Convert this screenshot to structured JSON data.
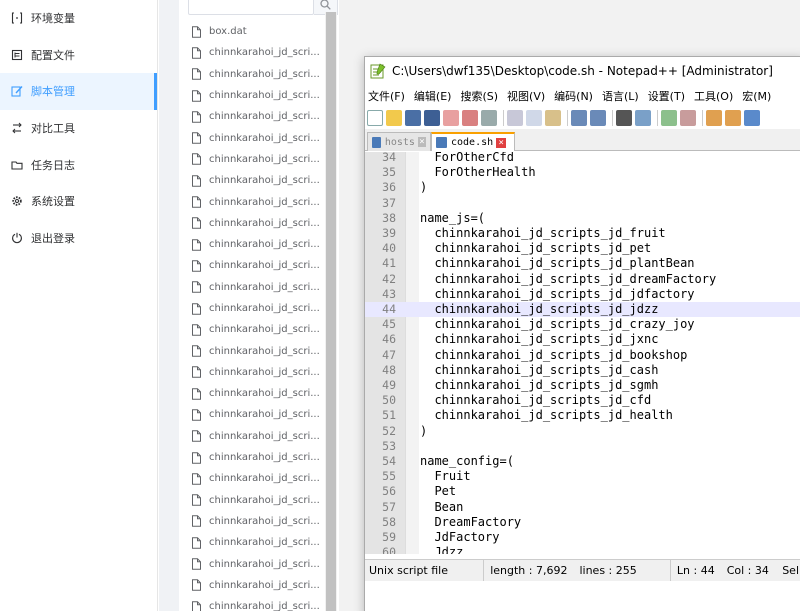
{
  "nav": {
    "items": [
      {
        "label": "环境变量",
        "icon": "variable-icon",
        "active": false
      },
      {
        "label": "配置文件",
        "icon": "config-file-icon",
        "active": false
      },
      {
        "label": "脚本管理",
        "icon": "script-edit-icon",
        "active": true
      },
      {
        "label": "对比工具",
        "icon": "compare-icon",
        "active": false
      },
      {
        "label": "任务日志",
        "icon": "folder-log-icon",
        "active": false
      },
      {
        "label": "系统设置",
        "icon": "settings-gear-icon",
        "active": false
      },
      {
        "label": "退出登录",
        "icon": "logout-icon",
        "active": false
      }
    ]
  },
  "files": {
    "search_placeholder": "",
    "items": [
      "box.dat",
      "chinnkarahoi_jd_scri...",
      "chinnkarahoi_jd_scri...",
      "chinnkarahoi_jd_scri...",
      "chinnkarahoi_jd_scri...",
      "chinnkarahoi_jd_scri...",
      "chinnkarahoi_jd_scri...",
      "chinnkarahoi_jd_scri...",
      "chinnkarahoi_jd_scri...",
      "chinnkarahoi_jd_scri...",
      "chinnkarahoi_jd_scri...",
      "chinnkarahoi_jd_scri...",
      "chinnkarahoi_jd_scri...",
      "chinnkarahoi_jd_scri...",
      "chinnkarahoi_jd_scri...",
      "chinnkarahoi_jd_scri...",
      "chinnkarahoi_jd_scri...",
      "chinnkarahoi_jd_scri...",
      "chinnkarahoi_jd_scri...",
      "chinnkarahoi_jd_scri...",
      "chinnkarahoi_jd_scri...",
      "chinnkarahoi_jd_scri...",
      "chinnkarahoi_jd_scri...",
      "chinnkarahoi_jd_scri...",
      "chinnkarahoi_jd_scri...",
      "chinnkarahoi_jd_scri...",
      "chinnkarahoi_jd_scri...",
      "chinnkarahoi_jd_scri...",
      "chinnkarahoi_jd_scri..."
    ]
  },
  "npp": {
    "title": "C:\\Users\\dwf135\\Desktop\\code.sh - Notepad++ [Administrator]",
    "menu": [
      "文件(F)",
      "编辑(E)",
      "搜索(S)",
      "视图(V)",
      "编码(N)",
      "语言(L)",
      "设置(T)",
      "工具(O)",
      "宏(M)"
    ],
    "tabs": [
      {
        "label": "hosts",
        "active": false
      },
      {
        "label": "code.sh",
        "active": true
      }
    ],
    "current_line": 44,
    "lines": [
      {
        "n": "34",
        "t": "  ForOtherCfd"
      },
      {
        "n": "35",
        "t": "  ForOtherHealth"
      },
      {
        "n": "36",
        "t": ")"
      },
      {
        "n": "37",
        "t": ""
      },
      {
        "n": "38",
        "t": "name_js=("
      },
      {
        "n": "39",
        "t": "  chinnkarahoi_jd_scripts_jd_fruit"
      },
      {
        "n": "40",
        "t": "  chinnkarahoi_jd_scripts_jd_pet"
      },
      {
        "n": "41",
        "t": "  chinnkarahoi_jd_scripts_jd_plantBean"
      },
      {
        "n": "42",
        "t": "  chinnkarahoi_jd_scripts_jd_dreamFactory"
      },
      {
        "n": "43",
        "t": "  chinnkarahoi_jd_scripts_jd_jdfactory"
      },
      {
        "n": "44",
        "t": "  chinnkarahoi_jd_scripts_jd_jdzz"
      },
      {
        "n": "45",
        "t": "  chinnkarahoi_jd_scripts_jd_crazy_joy"
      },
      {
        "n": "46",
        "t": "  chinnkarahoi_jd_scripts_jd_jxnc"
      },
      {
        "n": "47",
        "t": "  chinnkarahoi_jd_scripts_jd_bookshop"
      },
      {
        "n": "48",
        "t": "  chinnkarahoi_jd_scripts_jd_cash"
      },
      {
        "n": "49",
        "t": "  chinnkarahoi_jd_scripts_jd_sgmh"
      },
      {
        "n": "50",
        "t": "  chinnkarahoi_jd_scripts_jd_cfd"
      },
      {
        "n": "51",
        "t": "  chinnkarahoi_jd_scripts_jd_health"
      },
      {
        "n": "52",
        "t": ")"
      },
      {
        "n": "53",
        "t": ""
      },
      {
        "n": "54",
        "t": "name_config=("
      },
      {
        "n": "55",
        "t": "  Fruit"
      },
      {
        "n": "56",
        "t": "  Pet"
      },
      {
        "n": "57",
        "t": "  Bean"
      },
      {
        "n": "58",
        "t": "  DreamFactory"
      },
      {
        "n": "59",
        "t": "  JdFactory"
      },
      {
        "n": "60",
        "t": "  Jdzz"
      }
    ],
    "status": {
      "filetype": "Unix script file",
      "length": "length : 7,692",
      "lines": "lines : 255",
      "ln": "Ln : 44",
      "col": "Col : 34",
      "sel": "Sel"
    }
  },
  "colors": {
    "accent": "#409eff",
    "active_bg": "#ecf5ff",
    "tab_accent": "#f9a000"
  }
}
